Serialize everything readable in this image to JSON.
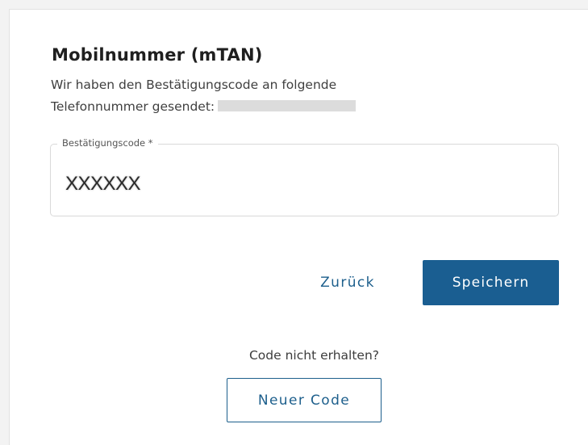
{
  "dialog": {
    "title": "Mobilnummer (mTAN)",
    "description_line1": "Wir haben den Bestätigungscode an folgende",
    "description_line2": "Telefonnummer gesendet:"
  },
  "code_field": {
    "label": "Bestätigungscode *",
    "value": "XXXXXX"
  },
  "actions": {
    "back_label": "Zurück",
    "save_label": "Speichern"
  },
  "resend": {
    "prompt": "Code nicht erhalten?",
    "button_label": "Neuer Code"
  },
  "colors": {
    "primary": "#1a5e91",
    "link": "#1d5f8c",
    "border": "#d9d9d9"
  }
}
